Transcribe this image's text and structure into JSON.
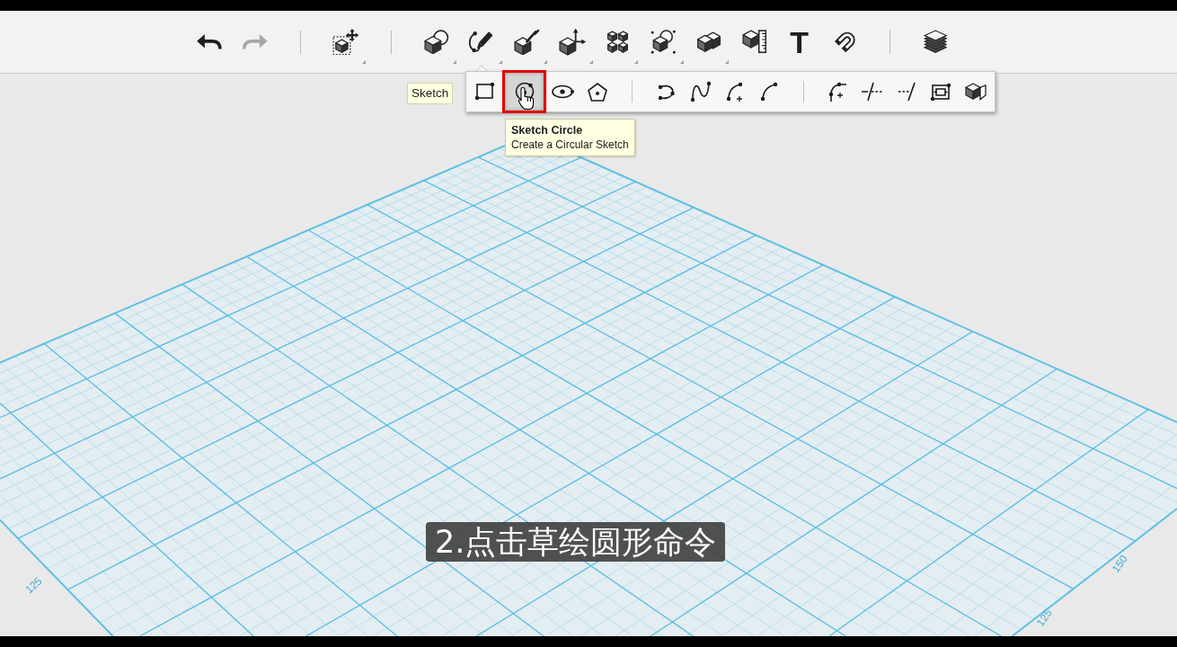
{
  "toolbar": {
    "groups": [
      {
        "tools": [
          {
            "kind": "undo",
            "disabled": false,
            "submenu": false,
            "expanded": false
          },
          {
            "kind": "redo",
            "disabled": true,
            "submenu": false,
            "expanded": false
          }
        ]
      },
      {
        "tools": [
          {
            "kind": "transform",
            "disabled": false,
            "submenu": true,
            "expanded": false
          }
        ]
      },
      {
        "tools": [
          {
            "kind": "primitive",
            "disabled": false,
            "submenu": true,
            "expanded": false
          },
          {
            "kind": "sketch",
            "disabled": false,
            "submenu": true,
            "expanded": true
          },
          {
            "kind": "construct",
            "disabled": false,
            "submenu": true,
            "expanded": false
          },
          {
            "kind": "modify",
            "disabled": false,
            "submenu": true,
            "expanded": false
          },
          {
            "kind": "pattern",
            "disabled": false,
            "submenu": true,
            "expanded": false
          },
          {
            "kind": "group",
            "disabled": false,
            "submenu": true,
            "expanded": false
          },
          {
            "kind": "combine",
            "disabled": false,
            "submenu": true,
            "expanded": false
          },
          {
            "kind": "measure",
            "disabled": false,
            "submenu": false,
            "expanded": false
          },
          {
            "kind": "text",
            "glyph": "T",
            "disabled": false,
            "submenu": false,
            "expanded": false
          },
          {
            "kind": "snap",
            "disabled": false,
            "submenu": false,
            "expanded": false
          }
        ]
      },
      {
        "tools": [
          {
            "kind": "material",
            "disabled": false,
            "submenu": false,
            "expanded": false
          }
        ]
      }
    ]
  },
  "flyout": {
    "label": "Sketch",
    "groups": [
      {
        "items": [
          {
            "kind": "rectangle",
            "selected": false
          },
          {
            "kind": "circle",
            "selected": true
          },
          {
            "kind": "ellipse",
            "selected": false
          },
          {
            "kind": "polygon",
            "selected": false
          }
        ]
      },
      {
        "items": [
          {
            "kind": "spline",
            "selected": false
          },
          {
            "kind": "wave",
            "selected": false
          },
          {
            "kind": "arcplus",
            "selected": false
          },
          {
            "kind": "arc",
            "selected": false
          }
        ]
      },
      {
        "items": [
          {
            "kind": "fillet",
            "selected": false
          },
          {
            "kind": "trim",
            "selected": false
          },
          {
            "kind": "extend",
            "selected": false
          },
          {
            "kind": "offset",
            "selected": false
          },
          {
            "kind": "extrude",
            "selected": false
          }
        ]
      }
    ]
  },
  "tooltip": {
    "title": "Sketch Circle",
    "text": "Create a Circular Sketch"
  },
  "grid": {
    "labels": [
      "125",
      "150",
      "125"
    ]
  },
  "caption": "2.点击草绘圆形命令"
}
